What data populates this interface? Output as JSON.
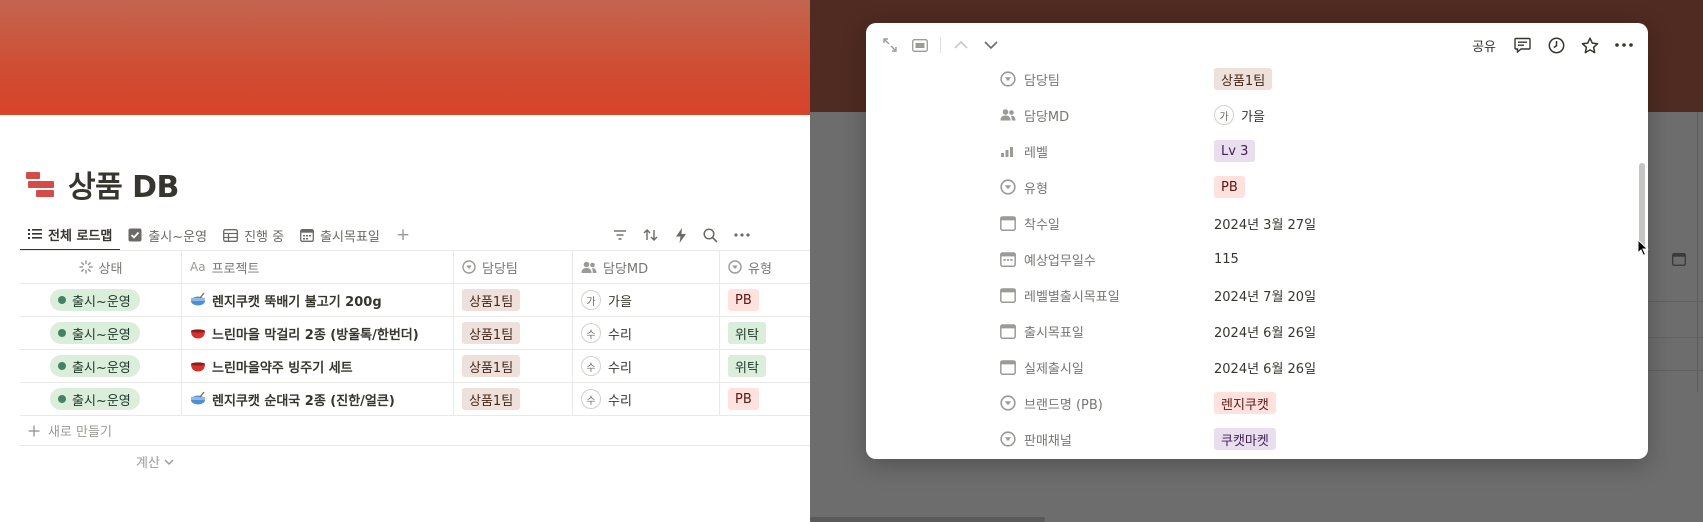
{
  "page": {
    "title": "상품 DB",
    "icon": "bricks-icon"
  },
  "views": {
    "tabs": [
      {
        "label": "전체 로드맵",
        "icon": "list-icon",
        "active": true
      },
      {
        "label": "출시~운영",
        "icon": "checkbox-icon",
        "active": false
      },
      {
        "label": "진행 중",
        "icon": "table-icon",
        "active": false
      },
      {
        "label": "출시목표일",
        "icon": "calendar-icon",
        "active": false
      }
    ],
    "add_label": "+",
    "tools": [
      "filter-icon",
      "sort-icon",
      "automation-bolt-icon",
      "search-icon",
      "more-icon"
    ]
  },
  "table": {
    "columns": [
      {
        "label": "상태",
        "icon": "status-spinner-icon"
      },
      {
        "label": "프로젝트",
        "icon_text": "Aa"
      },
      {
        "label": "담당팀",
        "icon": "select-icon"
      },
      {
        "label": "담당MD",
        "icon": "people-icon"
      },
      {
        "label": "유형",
        "icon": "select-icon"
      }
    ],
    "rows": [
      {
        "status": "출시~운영",
        "project": "렌지쿠캣 뚝배기 불고기 200g",
        "project_icon": "pot-icon",
        "team": "상품1팀",
        "md_initial": "가",
        "md": "가을",
        "type": "PB",
        "type_color": "red"
      },
      {
        "status": "출시~운영",
        "project": "느린마을 막걸리 2종 (방울톡/한번더)",
        "project_icon": "bowl-icon",
        "team": "상품1팀",
        "md_initial": "수",
        "md": "수리",
        "type": "위탁",
        "type_color": "green"
      },
      {
        "status": "출시~운영",
        "project": "느린마을약주 빙주기 세트",
        "project_icon": "bowl-icon",
        "team": "상품1팀",
        "md_initial": "수",
        "md": "수리",
        "type": "위탁",
        "type_color": "green"
      },
      {
        "status": "출시~운영",
        "project": "렌지쿠캣 순대국 2종 (진한/얼큰)",
        "project_icon": "pot-icon",
        "team": "상품1팀",
        "md_initial": "수",
        "md": "수리",
        "type": "PB",
        "type_color": "red"
      }
    ],
    "new_label": "새로 만들기",
    "calc_label": "계산"
  },
  "modal": {
    "share_label": "공유",
    "properties": [
      {
        "name": "담당팀",
        "icon": "select-icon",
        "value": "상품1팀",
        "kind": "tag",
        "color": "brown"
      },
      {
        "name": "담당MD",
        "icon": "people-icon",
        "value": "가을",
        "kind": "person",
        "initial": "가"
      },
      {
        "name": "레벨",
        "icon": "bars-icon",
        "value": "Lv 3",
        "kind": "tag",
        "color": "purple"
      },
      {
        "name": "유형",
        "icon": "select-icon",
        "value": "PB",
        "kind": "tag",
        "color": "red"
      },
      {
        "name": "착수일",
        "icon": "date-icon",
        "value": "2024년 3월 27일",
        "kind": "text"
      },
      {
        "name": "예상업무일수",
        "icon": "calendar-icon",
        "value": "115",
        "kind": "text"
      },
      {
        "name": "레벨별출시목표일",
        "icon": "date-icon",
        "value": "2024년 7월 20일",
        "kind": "text"
      },
      {
        "name": "출시목표일",
        "icon": "date-icon",
        "value": "2024년 6월 26일",
        "kind": "text"
      },
      {
        "name": "실제출시일",
        "icon": "date-icon",
        "value": "2024년 6월 26일",
        "kind": "text"
      },
      {
        "name": "브랜드명 (PB)",
        "icon": "select-icon",
        "value": "렌지쿠캣",
        "kind": "tag",
        "color": "red"
      },
      {
        "name": "판매채널",
        "icon": "select-icon",
        "value": "쿠캣마켓",
        "kind": "tag",
        "color": "purple"
      }
    ]
  },
  "colors": {
    "cover": "#d8432a",
    "overlay": "#6d6d6d",
    "status_green": "#448361"
  }
}
